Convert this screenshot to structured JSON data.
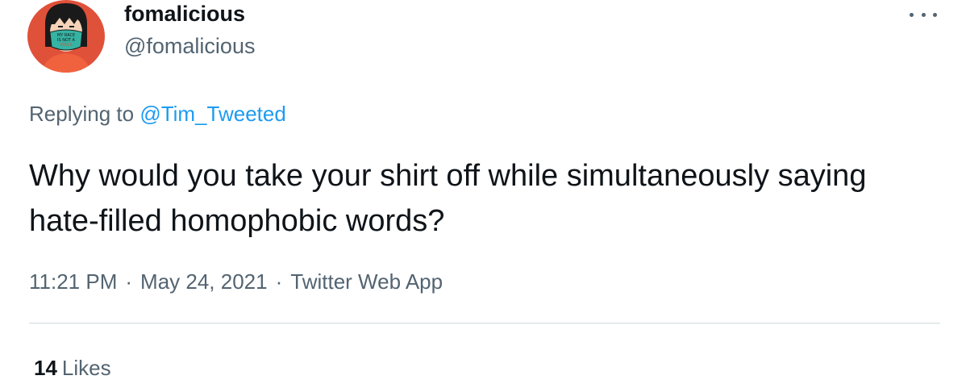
{
  "author": {
    "display_name": "fomalicious",
    "handle": "@fomalicious",
    "avatar_mask_text": [
      "MY RACE",
      "IS NOT A",
      "VIRUS"
    ]
  },
  "reply": {
    "prefix": "Replying to ",
    "target": "@Tim_Tweeted"
  },
  "tweet": {
    "text": "Why would you take your shirt off while simultaneously saying hate-filled homophobic words?"
  },
  "meta": {
    "time": "11:21 PM",
    "date": "May 24, 2021",
    "separator": "·",
    "source": "Twitter Web App"
  },
  "stats": {
    "likes_count": "14",
    "likes_label": "Likes"
  },
  "icons": {
    "more": "more-horizontal-icon"
  },
  "colors": {
    "avatar_background": "#e0513a",
    "mask": "#35b3a3",
    "link": "#1d9bf0",
    "secondary_text": "#536471"
  }
}
